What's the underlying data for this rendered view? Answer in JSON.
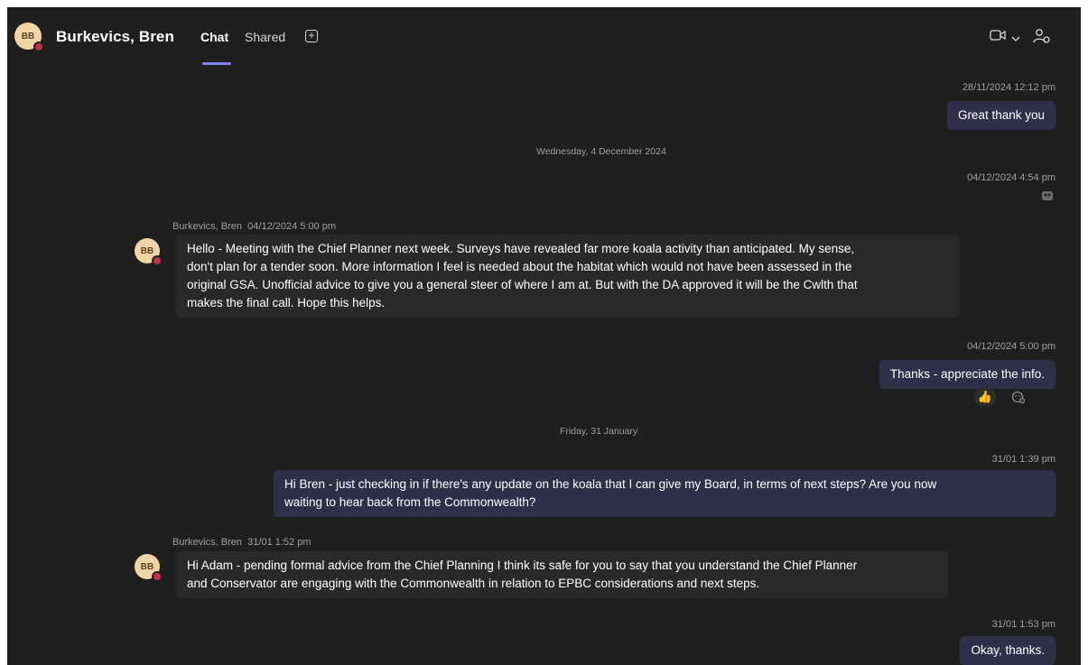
{
  "header": {
    "avatar_initials": "BB",
    "contact_name": "Burkevics, Bren",
    "tabs": [
      {
        "label": "Chat"
      },
      {
        "label": "Shared"
      }
    ],
    "add_tab_glyph": "+",
    "icons": [
      "video-icon",
      "chevron-down-icon",
      "people-settings-icon"
    ]
  },
  "colors": {
    "background": "#1f1f1f",
    "outgoing_bubble": "#2f2f4a",
    "incoming_bubble": "#292929",
    "accent": "#7f85f5",
    "presence_busy": "#c4314b",
    "avatar_bg": "#f1d5a7"
  },
  "messages": {
    "m1": {
      "timestamp": "28/11/2024 12:12 pm",
      "text": "Great thank you"
    },
    "divider1": "Wednesday, 4 December 2024",
    "m2": {
      "timestamp": "04/12/2024 4:54 pm",
      "sticker": "gif-sticker-icon"
    },
    "m3": {
      "sender": "Burkevics, Bren",
      "timestamp": "04/12/2024 5:00 pm",
      "avatar_initials": "BB",
      "lines": [
        "Hello - Meeting with the Chief Planner next week. Surveys have revealed far more koala activity than anticipated. My sense,",
        "don't plan for a tender soon. More information I feel is needed about the habitat which would not have been assessed in the",
        "original GSA. Unofficial advice to give you a general steer of where I am at. But with the DA approved it will be the Cwlth that",
        "makes the final call. Hope this helps."
      ]
    },
    "m4": {
      "timestamp": "04/12/2024 5:00 pm",
      "text": "Thanks - appreciate the info.",
      "reaction": "👍"
    },
    "divider2": "Friday, 31 January",
    "m5": {
      "timestamp": "31/01 1:39 pm",
      "lines": [
        "Hi Bren - just checking in if there's any update on the koala that I can give my Board, in terms of next steps? Are you now",
        "waiting to hear back from the Commonwealth?"
      ]
    },
    "m6": {
      "sender": "Burkevics, Bren",
      "timestamp": "31/01 1:52 pm",
      "avatar_initials": "BB",
      "lines": [
        "Hi Adam - pending formal advice from the Chief Planning I think its safe for you to say that you understand the Chief Planner",
        "and Conservator are engaging with the Commonwealth in relation to EPBC considerations and next steps."
      ]
    },
    "m7": {
      "timestamp": "31/01 1:53 pm",
      "text": "Okay, thanks."
    }
  }
}
